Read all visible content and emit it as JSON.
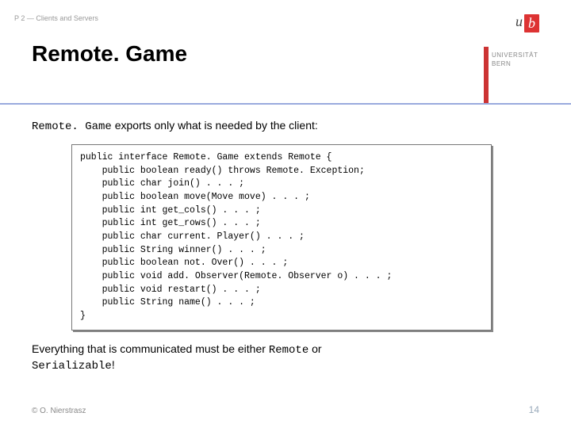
{
  "breadcrumb": "P 2 — Clients and Servers",
  "title": "Remote. Game",
  "logo": {
    "u": "u",
    "b": "b",
    "uni_line1": "UNIVERSITÄT",
    "uni_line2": "BERN"
  },
  "intro": {
    "code": "Remote. Game",
    "rest": " exports only what is needed by the client:"
  },
  "code_lines": [
    "public interface Remote. Game extends Remote {",
    "    public boolean ready() throws Remote. Exception;",
    "    public char join() . . . ;",
    "    public boolean move(Move move) . . . ;",
    "    public int get_cols() . . . ;",
    "    public int get_rows() . . . ;",
    "    public char current. Player() . . . ;",
    "    public String winner() . . . ;",
    "    public boolean not. Over() . . . ;",
    "    public void add. Observer(Remote. Observer o) . . . ;",
    "    public void restart() . . . ;",
    "    public String name() . . . ;",
    "}"
  ],
  "outro": {
    "before": "Everything that is communicated must be either ",
    "code1": "Remote",
    "mid": " or ",
    "code2": "Serializable",
    "after": "!"
  },
  "footer": {
    "left": "© O. Nierstrasz",
    "right": "14"
  }
}
